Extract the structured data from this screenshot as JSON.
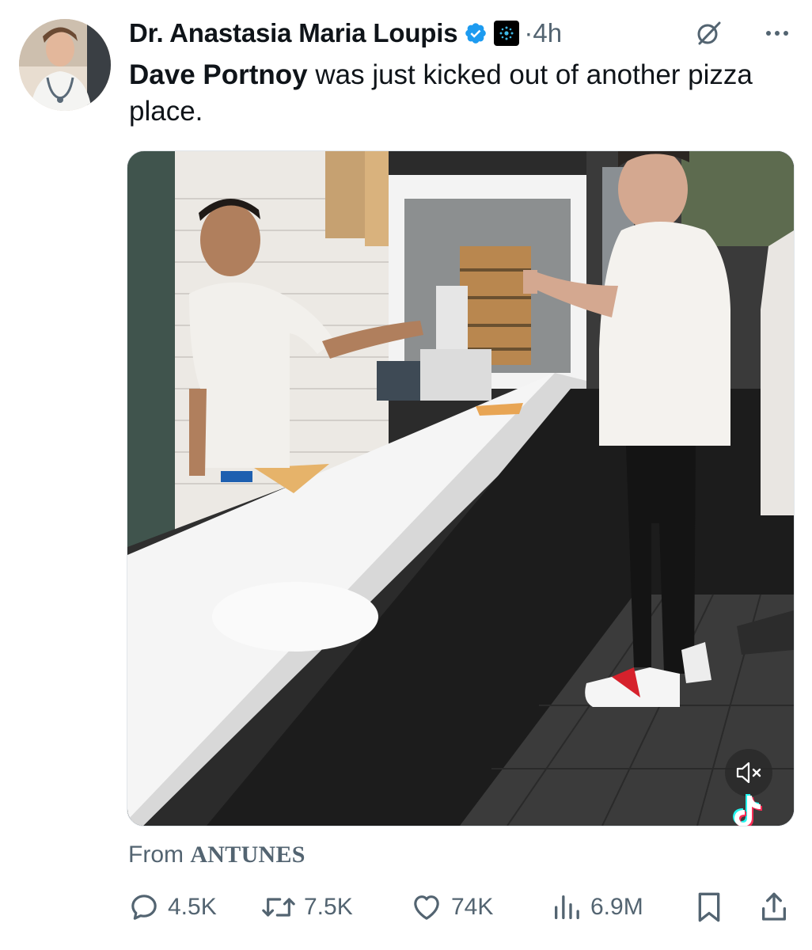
{
  "author": {
    "display_name": "Dr. Anastasia Maria Loupis",
    "verified": true,
    "separator": "·",
    "time": "4h"
  },
  "tweet": {
    "mention": "Dave Portnoy",
    "text": " was just kicked out of another pizza place."
  },
  "media": {
    "type": "video",
    "mute_icon": "speaker-muted-icon",
    "watermark_icon": "tiktok-icon"
  },
  "source": {
    "prefix": "From ",
    "name": "ANTUNES"
  },
  "actions": {
    "replies": "4.5K",
    "reposts": "7.5K",
    "likes": "74K",
    "views": "6.9M"
  },
  "colors": {
    "text": "#0f1419",
    "secondary": "#536471",
    "verified_blue": "#1d9bf0",
    "background": "#ffffff"
  }
}
